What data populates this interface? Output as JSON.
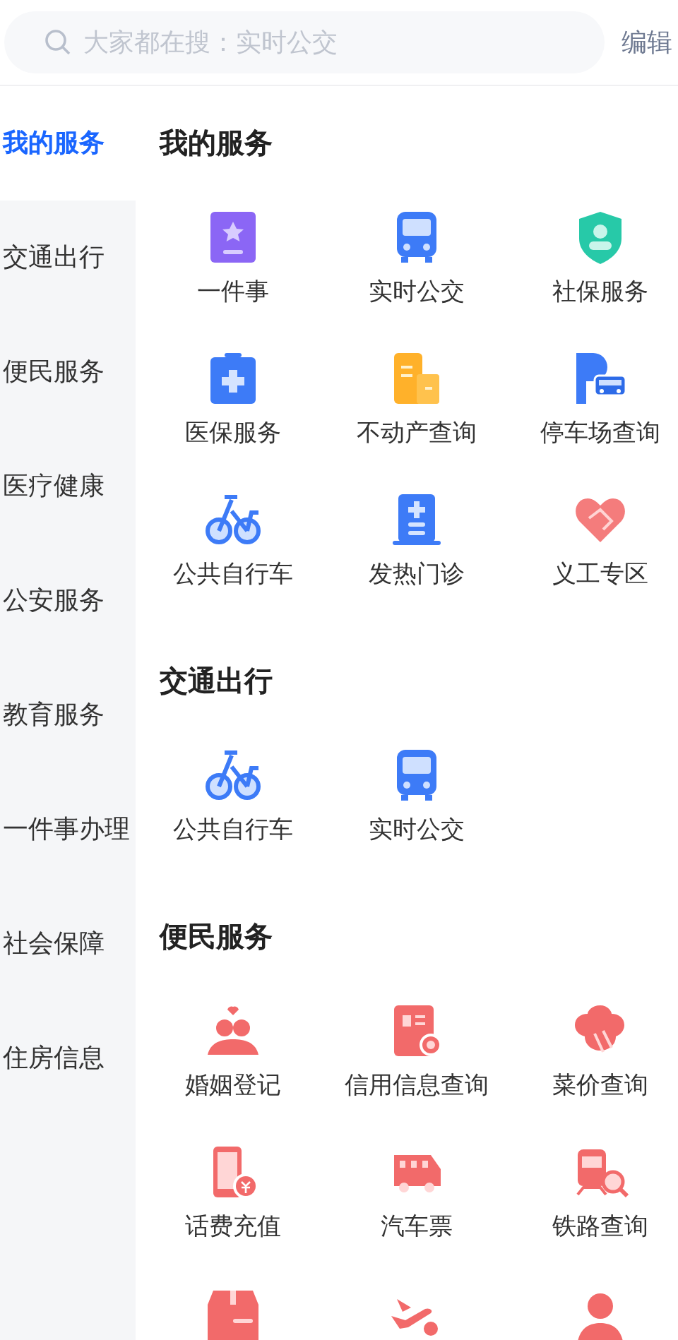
{
  "search": {
    "placeholder": "大家都在搜：实时公交"
  },
  "edit_button": "编辑",
  "sidebar": {
    "items": [
      {
        "label": "我的服务",
        "selected": true
      },
      {
        "label": "交通出行",
        "selected": false
      },
      {
        "label": "便民服务",
        "selected": false
      },
      {
        "label": "医疗健康",
        "selected": false
      },
      {
        "label": "公安服务",
        "selected": false
      },
      {
        "label": "教育服务",
        "selected": false
      },
      {
        "label": "一件事办理",
        "selected": false
      },
      {
        "label": "社会保障",
        "selected": false
      },
      {
        "label": "住房信息",
        "selected": false
      }
    ]
  },
  "sections": [
    {
      "title": "我的服务",
      "items": [
        {
          "kind": "labeled",
          "label": "一件事"
        },
        {
          "kind": "labeled",
          "label": "实时公交"
        },
        {
          "kind": "labeled",
          "label": "社保服务"
        },
        {
          "kind": "labeled",
          "label": "医保服务"
        },
        {
          "kind": "labeled",
          "label": "不动产查询"
        },
        {
          "kind": "labeled",
          "label": "停车场查询"
        },
        {
          "kind": "labeled",
          "label": "公共自行车"
        },
        {
          "kind": "labeled",
          "label": "发热门诊"
        },
        {
          "kind": "labeled",
          "label": "义工专区"
        }
      ]
    },
    {
      "title": "交通出行",
      "items": [
        {
          "kind": "labeled",
          "label": "公共自行车"
        },
        {
          "kind": "labeled",
          "label": "实时公交"
        }
      ]
    },
    {
      "title": "便民服务",
      "items": [
        {
          "kind": "labeled",
          "label": "婚姻登记"
        },
        {
          "kind": "labeled",
          "label": "信用信息查询"
        },
        {
          "kind": "labeled",
          "label": "菜价查询"
        },
        {
          "kind": "labeled",
          "label": "话费充值"
        },
        {
          "kind": "labeled",
          "label": "汽车票"
        },
        {
          "kind": "labeled",
          "label": "铁路查询"
        },
        {
          "kind": "icon_only"
        },
        {
          "kind": "icon_only"
        },
        {
          "kind": "icon_only"
        }
      ]
    }
  ]
}
